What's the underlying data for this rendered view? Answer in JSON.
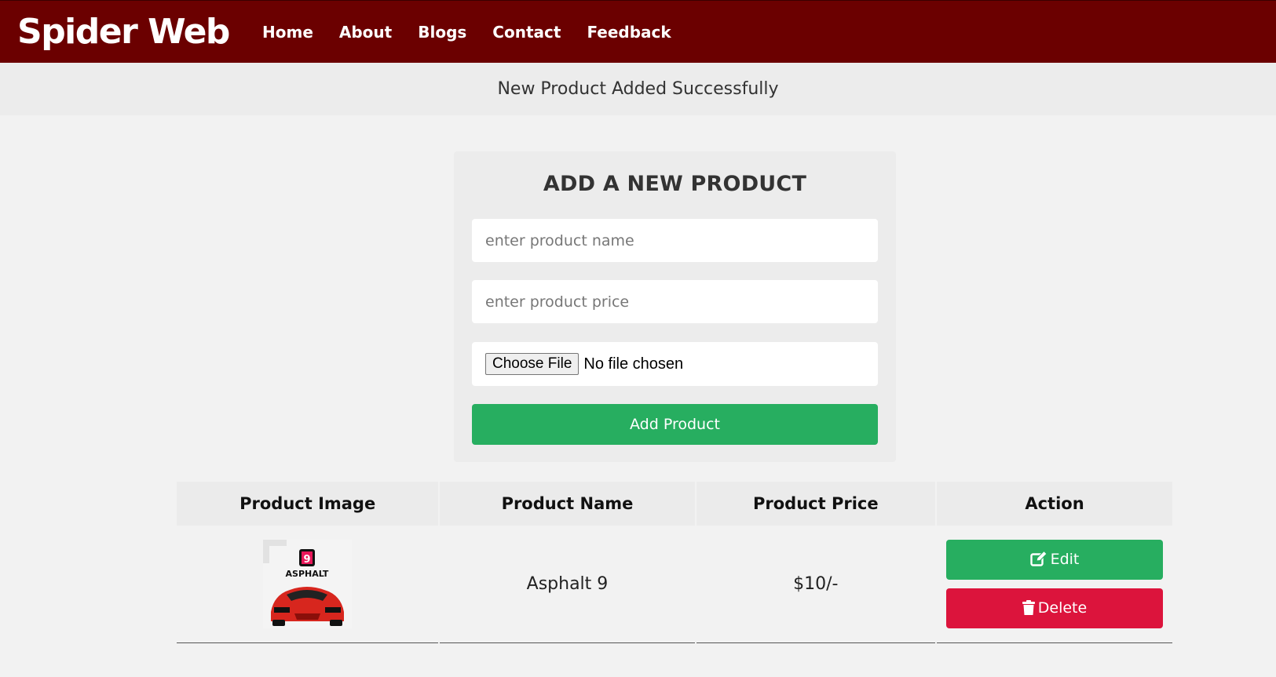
{
  "header": {
    "logo": "Spider Web",
    "nav": [
      {
        "label": "Home"
      },
      {
        "label": "About"
      },
      {
        "label": "Blogs"
      },
      {
        "label": "Contact"
      },
      {
        "label": "Feedback"
      }
    ],
    "bg_color": "#6b0000"
  },
  "message": "New Product Added Successfully",
  "form": {
    "title": "ADD A NEW PRODUCT",
    "name_placeholder": "enter product name",
    "price_placeholder": "enter product price",
    "file_button": "Choose File",
    "file_status": "No file chosen",
    "submit_label": "Add Product",
    "submit_color": "#27ae60"
  },
  "table": {
    "headers": [
      "Product Image",
      "Product Name",
      "Product Price",
      "Action"
    ],
    "rows": [
      {
        "image_text": "ASPHALT",
        "image_badge": "9",
        "name": "Asphalt 9",
        "price": "$10/-",
        "edit_label": "Edit",
        "delete_label": "Delete",
        "edit_icon": "edit-icon",
        "delete_icon": "trash-icon"
      }
    ]
  },
  "colors": {
    "edit": "#27ae60",
    "delete": "#dc143c"
  }
}
